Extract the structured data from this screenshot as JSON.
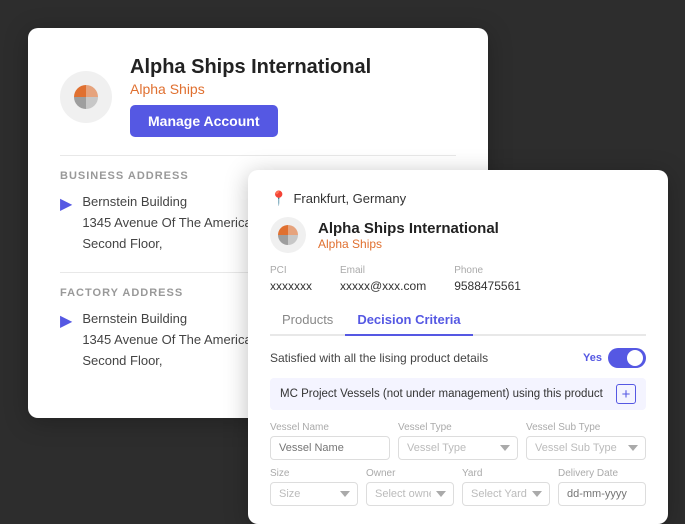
{
  "back_card": {
    "company_name": "Alpha Ships International",
    "subtitle": "Alpha Ships",
    "manage_btn": "Manage Account",
    "business_address_title": "BUSINESS ADDRESS",
    "business_address_line1": "Bernstein Building",
    "business_address_line2": "1345 Avenue Of The America",
    "business_address_line3": "Second Floor,",
    "factory_address_title": "FACTORY ADDRESS",
    "factory_address_line1": "Bernstein Building",
    "factory_address_line2": "1345 Avenue Of The America",
    "factory_address_line3": "Second Floor,"
  },
  "front_card": {
    "company_name": "Alpha Ships International",
    "subtitle": "Alpha Ships",
    "location": "Frankfurt, Germany",
    "pci_label": "PCI",
    "pci_value": "xxxxxxx",
    "email_label": "Email",
    "email_value": "xxxxx@xxx.com",
    "phone_label": "Phone",
    "phone_value": "9588475561",
    "tabs": [
      {
        "label": "Products",
        "active": false
      },
      {
        "label": "Decision Criteria",
        "active": true
      }
    ],
    "satisfied_label": "Satisfied with all the lising product details",
    "toggle_yes": "Yes",
    "mc_label": "MC Project Vessels (not under management) using this product",
    "vessel_name_label": "Vessel Name",
    "vessel_name_placeholder": "Vessel Name",
    "vessel_type_label": "Vessel Type",
    "vessel_type_placeholder": "Vessel Type",
    "vessel_sub_type_label": "Vessel Sub Type",
    "vessel_sub_type_placeholder": "Vessel Sub Type",
    "size_label": "Size",
    "size_placeholder": "Size",
    "owner_label": "Owner",
    "owner_placeholder": "Select owner",
    "yard_label": "Yard",
    "yard_placeholder": "Select Yard",
    "delivery_date_label": "Delivery Date",
    "delivery_date_placeholder": "dd-mm-yyyy"
  },
  "colors": {
    "accent": "#5558e3",
    "orange": "#e07030",
    "logo_orange": "#e07030",
    "logo_gray": "#9e9e9e"
  }
}
